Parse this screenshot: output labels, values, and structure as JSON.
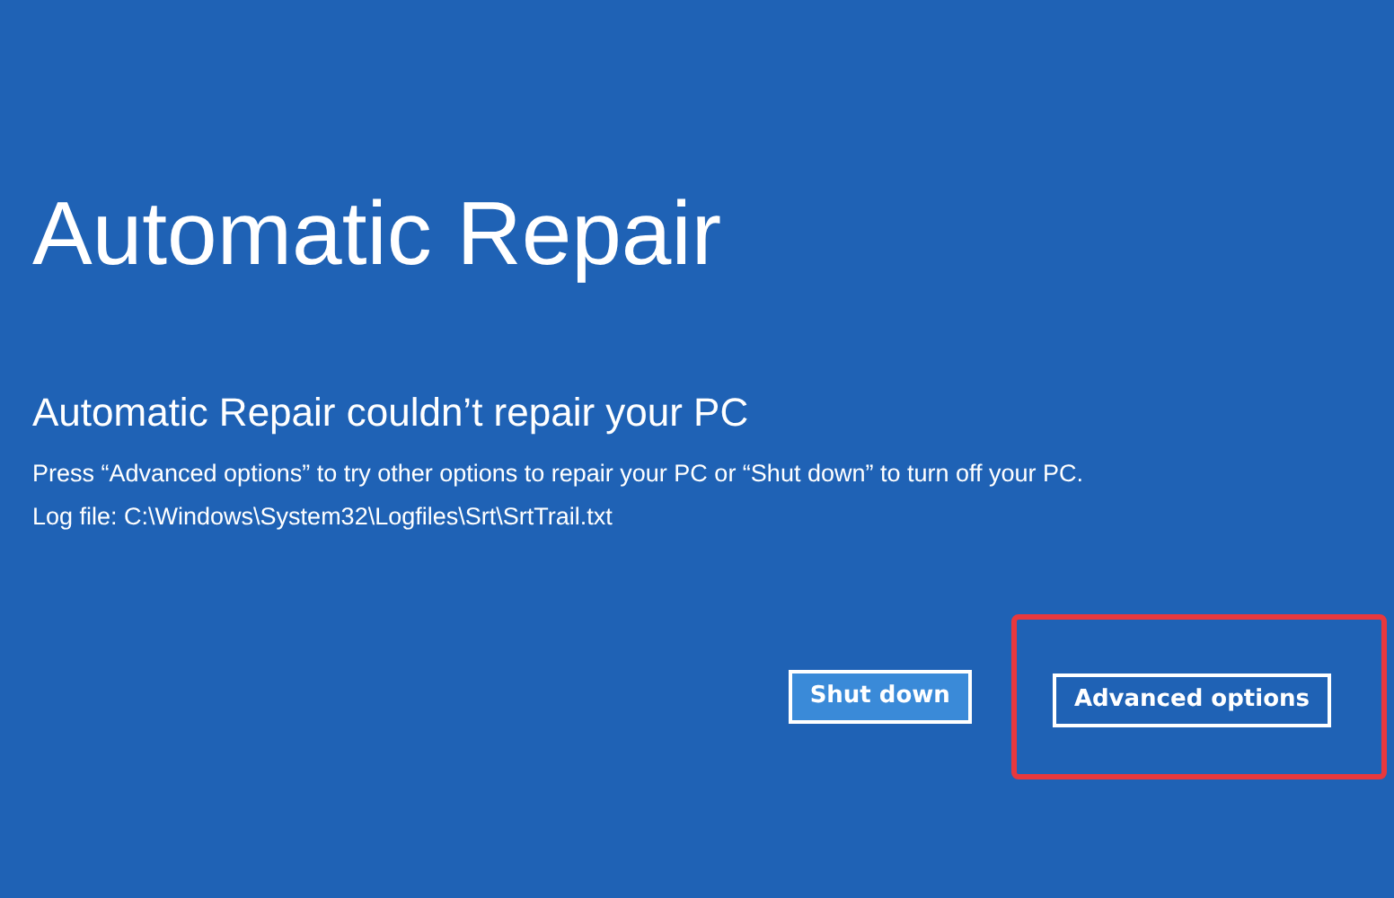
{
  "title": "Automatic Repair",
  "heading": "Automatic Repair couldn’t repair your PC",
  "message": "Press “Advanced options” to try other options to repair your PC or “Shut down” to turn off your PC.",
  "log": "Log file: C:\\Windows\\System32\\Logfiles\\Srt\\SrtTrail.txt",
  "buttons": [
    {
      "label": "Shut down",
      "selected": true,
      "highlighted": false
    },
    {
      "label": "Advanced options",
      "selected": false,
      "highlighted": true
    }
  ]
}
